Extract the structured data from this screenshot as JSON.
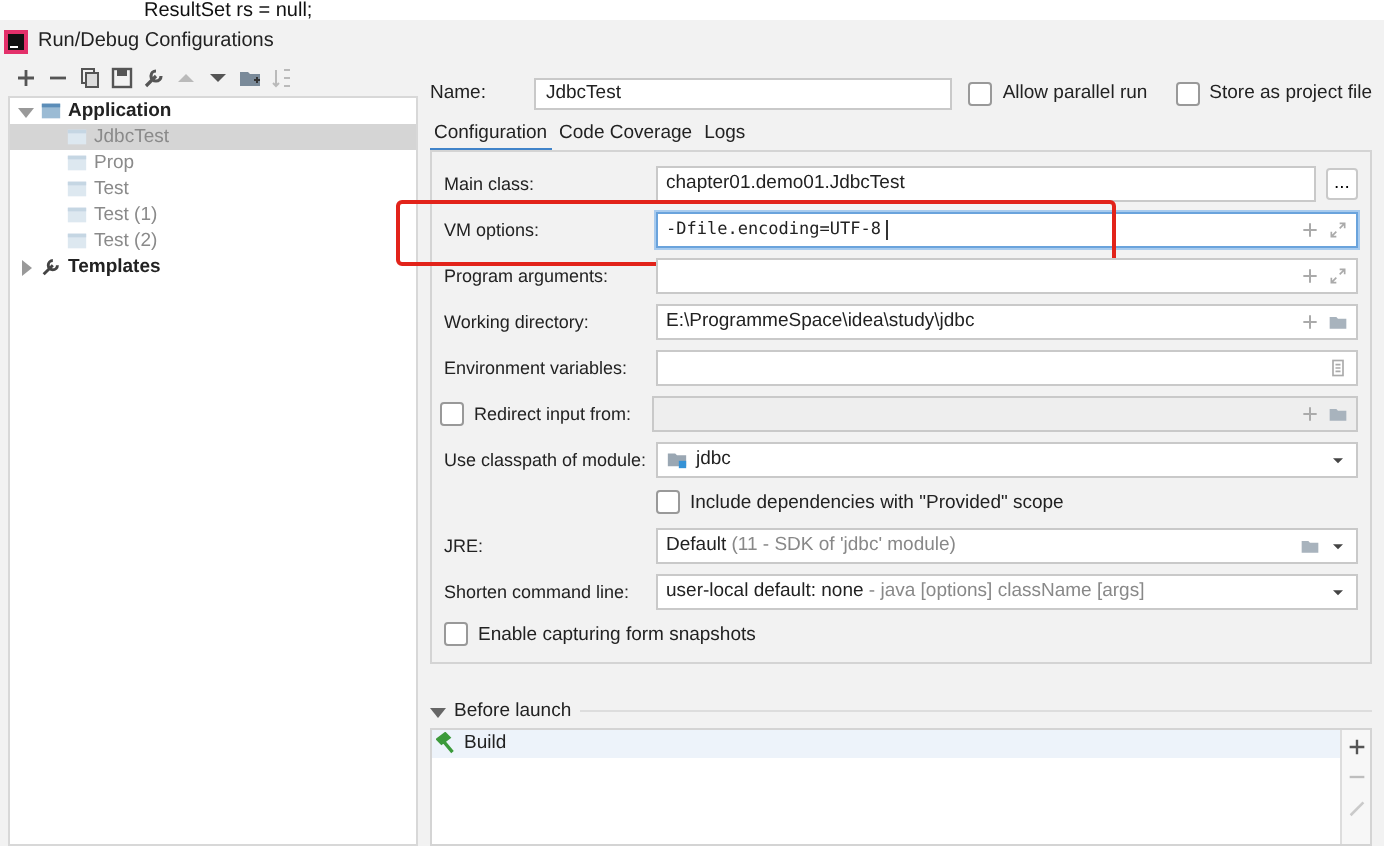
{
  "editor_behind": {
    "code": "ResultSet rs = null;"
  },
  "window": {
    "title": "Run/Debug Configurations"
  },
  "toolbar": [
    {
      "kind": "add"
    },
    {
      "kind": "remove"
    },
    {
      "kind": "copy"
    },
    {
      "kind": "save"
    },
    {
      "kind": "wrench"
    },
    {
      "kind": "up",
      "disabled": true
    },
    {
      "kind": "down",
      "disabled": false
    },
    {
      "kind": "folder",
      "disabled": false
    },
    {
      "kind": "sort",
      "disabled": true
    }
  ],
  "tree": [
    {
      "label": "Application",
      "kind": "group",
      "expanded": true,
      "children": [
        {
          "label": "JdbcTest",
          "selected": true,
          "dimmed": true
        },
        {
          "label": "Prop",
          "selected": false,
          "dimmed": true
        },
        {
          "label": "Test",
          "selected": false,
          "dimmed": true
        },
        {
          "label": "Test (1)",
          "selected": false,
          "dimmed": true
        },
        {
          "label": "Test (2)",
          "selected": false,
          "dimmed": true
        }
      ]
    },
    {
      "label": "Templates",
      "kind": "templates",
      "expanded": false
    }
  ],
  "name": {
    "label": "Name:",
    "value": "JdbcTest"
  },
  "options": [
    {
      "label": "Allow parallel run",
      "checked": false
    },
    {
      "label": "Store as project file",
      "checked": false
    }
  ],
  "tabs": [
    {
      "label": "Configuration",
      "selected": true
    },
    {
      "label": "Code Coverage",
      "selected": false
    },
    {
      "label": "Logs",
      "selected": false
    }
  ],
  "rows": [
    {
      "kind": "text",
      "label": "Main class:",
      "value": "chapter01.demo01.JdbcTest",
      "button": "..."
    },
    {
      "kind": "text",
      "label": "VM options:",
      "value": "-Dfile.encoding=UTF-8",
      "mono": true,
      "focused": true,
      "highlighted": true,
      "macros": true,
      "expandable": true
    },
    {
      "kind": "text",
      "label": "Program arguments:",
      "macros": true,
      "expandable": true
    },
    {
      "kind": "text",
      "label": "Working directory:",
      "value": "E:\\ProgrammeSpace\\idea\\study\\jdbc",
      "macros": true,
      "browsable": true
    },
    {
      "kind": "text",
      "label": "Environment variables:",
      "env_list": true
    },
    {
      "kind": "checkfield",
      "label": "Redirect input from:",
      "checked": false,
      "macros": true,
      "browsable": true
    },
    {
      "kind": "combo",
      "label": "Use classpath of module:",
      "value": "jdbc",
      "module_icon": true
    },
    {
      "kind": "checkbox",
      "label": "Include dependencies with \"Provided\" scope",
      "checked": false,
      "indented": true
    },
    {
      "kind": "combo",
      "label": "JRE:",
      "value": "Default",
      "hint": "(11 - SDK of 'jdbc' module)",
      "browsable": true
    },
    {
      "kind": "combo",
      "label": "Shorten command line:",
      "value": "user-local default: none",
      "hint": "- java [options] className [args]"
    },
    {
      "kind": "checkbox",
      "label": "Enable capturing form snapshots",
      "checked": false
    }
  ],
  "before_launch": {
    "label": "Before launch",
    "expanded": true,
    "items": [
      {
        "label": "Build",
        "selected": true
      }
    ],
    "buttons": [
      {
        "kind": "add",
        "disabled": false
      },
      {
        "kind": "remove",
        "disabled": true
      },
      {
        "kind": "edit",
        "disabled": true
      }
    ]
  }
}
